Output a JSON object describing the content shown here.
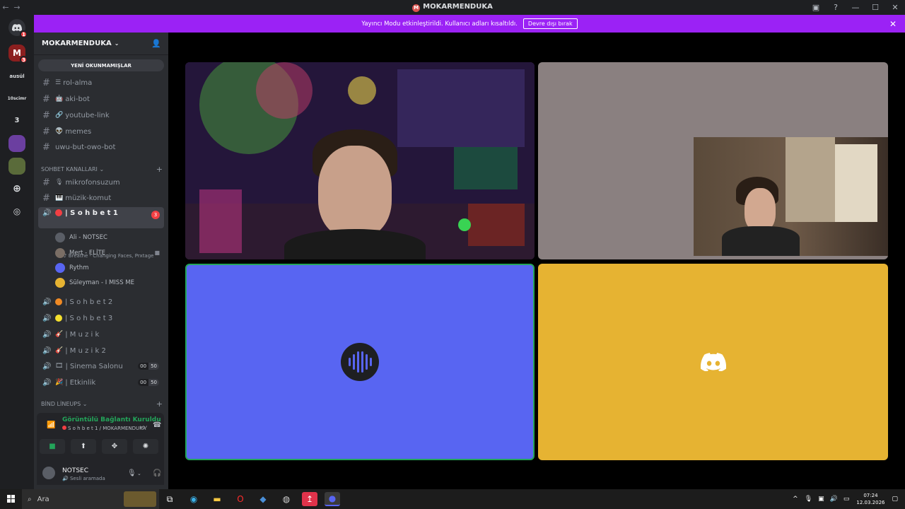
{
  "window": {
    "title": "MOKARMENDUKA",
    "back_icon": "←",
    "forward_icon": "→"
  },
  "notice": {
    "text": "Yayıncı Modu etkinleştirildi. Kullanıcı adları kısaltıldı.",
    "button": "Devre dışı bırak"
  },
  "guilds": [
    {
      "label": "",
      "badge": "1"
    },
    {
      "label": "M",
      "badge": "3"
    },
    {
      "label": "ausül",
      "badge": ""
    },
    {
      "label": "10scimr",
      "badge": ""
    },
    {
      "label": "3",
      "badge": ""
    },
    {
      "label": "",
      "badge": ""
    },
    {
      "label": "",
      "badge": ""
    }
  ],
  "server": {
    "name": "MOKARMENDUKA",
    "unread_pill": "YENİ OKUNMAMIŞLAR"
  },
  "text_channels": [
    {
      "icon": "☰",
      "name": "rol-alma"
    },
    {
      "icon": "🤖",
      "name": "aki-bot"
    },
    {
      "icon": "🔗",
      "name": "youtube-link"
    },
    {
      "icon": "👽",
      "name": "memes"
    },
    {
      "icon": "",
      "name": "uwu-but-owo-bot"
    }
  ],
  "categories": {
    "chat": "SOHBET KANALLARI",
    "bind": "BİND LİNEUPS"
  },
  "chat_channels": [
    {
      "icon": "🎙",
      "name": "mikrofonsuzum"
    },
    {
      "icon": "🎹",
      "name": "müzik-komut"
    }
  ],
  "voice_active": {
    "name": "| S o h b e t 1",
    "badge": "3",
    "activity": "Breathe - Changing Faces, Prxtage"
  },
  "voice_users": [
    {
      "name": "Ali - NOTSEC",
      "color": "#5a5e66"
    },
    {
      "name": "Mert - ELİTE",
      "color": "#7a6e65"
    },
    {
      "name": "Rythm",
      "color": "#5865f2"
    },
    {
      "name": "Süleyman - I MISS ME",
      "color": "#e6b332"
    }
  ],
  "voice_channels": [
    {
      "name": "| S o h b e t 2",
      "dot": "#f08a24",
      "limit": ""
    },
    {
      "name": "| S o h b e t 3",
      "dot": "#f5e02e",
      "limit": ""
    },
    {
      "name": "| M u z i k",
      "dot": "",
      "limit": ""
    },
    {
      "name": "| M u z i k 2",
      "dot": "",
      "limit": ""
    },
    {
      "name": "| Sinema Salonu",
      "dot": "",
      "limit": [
        "00",
        "50"
      ]
    },
    {
      "name": "| Etkinlik",
      "dot": "",
      "limit": [
        "00",
        "50"
      ]
    }
  ],
  "voice_panel": {
    "status": "Görüntülü Bağlantı Kuruldu",
    "channel": "S o h b e t 1 / MOKARMENDUKA"
  },
  "user": {
    "name": "NOTSEC",
    "status": "Sesli aramada"
  },
  "taskbar": {
    "search_placeholder": "Ara",
    "time": "07:24",
    "date": "12.03.2026"
  },
  "colors": {
    "notice_bg": "#9b22f5",
    "rythm_tile": "#5865f2",
    "suleyman_tile": "#e6b332",
    "speaking_border": "#23a55a"
  }
}
